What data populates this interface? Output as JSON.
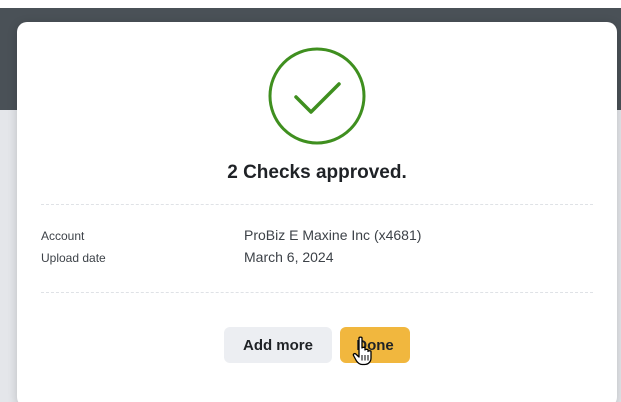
{
  "modal": {
    "title": "2 Checks approved.",
    "success_icon": "check-circle-icon",
    "details": [
      {
        "label": "Account",
        "value": "ProBiz E Maxine Inc (x4681)"
      },
      {
        "label": "Upload date",
        "value": "March 6, 2024"
      }
    ],
    "buttons": {
      "add_more": "Add more",
      "done": "Done"
    }
  },
  "colors": {
    "success_green": "#3f8f1f",
    "done_button": "#f1b73e",
    "secondary_button": "#eceef2",
    "header_bg": "#4a5157",
    "page_bg": "#e4e6ea"
  }
}
